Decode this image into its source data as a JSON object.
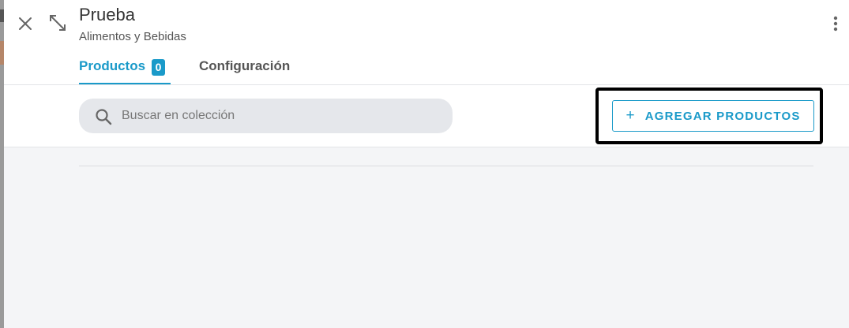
{
  "header": {
    "title": "Prueba",
    "subtitle": "Alimentos y Bebidas",
    "close_icon": "close-icon",
    "expand_icon": "expand-icon",
    "more_icon": "more-vertical-icon"
  },
  "tabs": [
    {
      "label": "Productos",
      "count": "0",
      "active": true
    },
    {
      "label": "Configuración",
      "active": false
    }
  ],
  "search": {
    "placeholder": "Buscar en colección",
    "value": "",
    "icon": "search-icon"
  },
  "toolbar": {
    "add_label": "AGREGAR PRODUCTOS",
    "add_icon": "+"
  },
  "colors": {
    "accent": "#1a9ac9",
    "background": "#f4f5f7",
    "highlight": "#000000"
  }
}
